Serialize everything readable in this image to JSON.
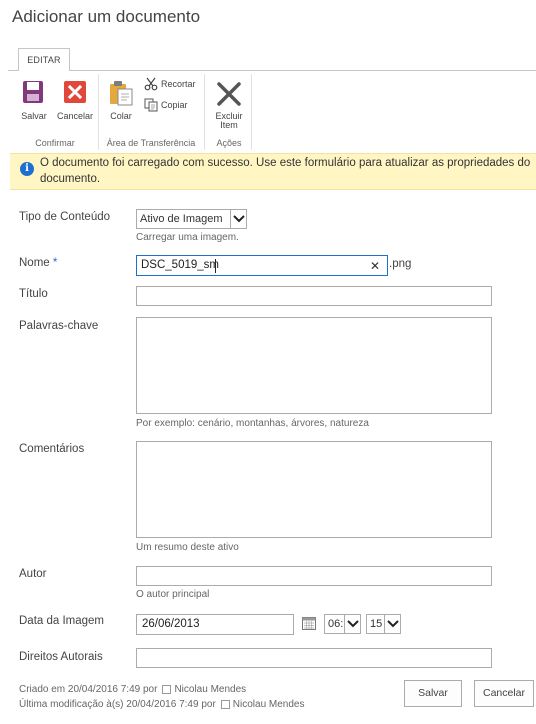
{
  "page": {
    "title": "Adicionar um documento"
  },
  "ribbon": {
    "tab": "EDITAR",
    "confirm_group": {
      "label": "Confirmar",
      "save": "Salvar",
      "cancel": "Cancelar"
    },
    "clipboard_group": {
      "label": "Área de Transferência",
      "paste": "Colar",
      "cut": "Recortar",
      "copy": "Copiar"
    },
    "actions_group": {
      "label": "Ações",
      "delete_line1": "Excluir",
      "delete_line2": "Item"
    }
  },
  "message": {
    "text": "O documento foi carregado com sucesso. Use este formulário para atualizar as propriedades do documento."
  },
  "form": {
    "content_type": {
      "label": "Tipo de Conteúdo",
      "value": "Ativo de Imagem",
      "hint": "Carregar uma imagem."
    },
    "name": {
      "label": "Nome",
      "required_marker": "*",
      "value": "DSC_5019_sm",
      "extension": ".png",
      "clear_glyph": "✕"
    },
    "title": {
      "label": "Título",
      "value": ""
    },
    "keywords": {
      "label": "Palavras-chave",
      "value": "",
      "hint": "Por exemplo: cenário, montanhas, árvores, natureza"
    },
    "comments": {
      "label": "Comentários",
      "value": "",
      "hint": "Um resumo deste ativo"
    },
    "author": {
      "label": "Autor",
      "value": "",
      "hint": "O autor principal"
    },
    "image_date": {
      "label": "Data da Imagem",
      "date": "26/06/2013",
      "hour": "06:",
      "minute": "15"
    },
    "copyright": {
      "label": "Direitos Autorais",
      "value": ""
    }
  },
  "footer": {
    "created_prefix": "Criado em 20/04/2016 7:49  por",
    "created_by": "Nicolau Mendes",
    "modified_prefix": "Última modificação à(s) 20/04/2016 7:49  por",
    "modified_by": "Nicolau Mendes",
    "save_button": "Salvar",
    "cancel_button": "Cancelar"
  },
  "colors": {
    "accent_blue": "#1f6fd1",
    "save_purple": "#80397b",
    "cancel_red": "#e0483b",
    "message_bg": "#fff6c4"
  }
}
